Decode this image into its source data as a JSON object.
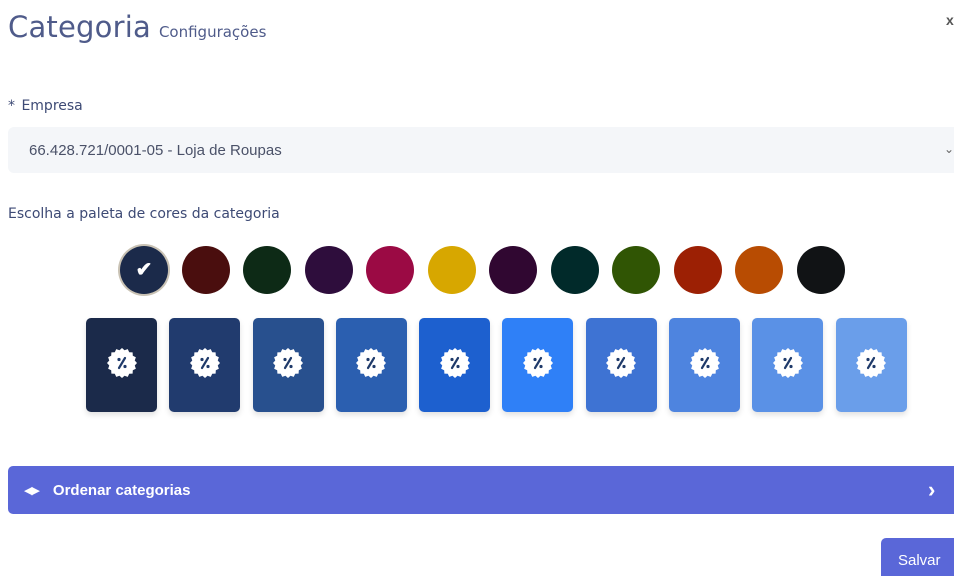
{
  "header": {
    "title": "Categoria",
    "subtitle": "Configurações",
    "close_label": "x"
  },
  "empresa": {
    "required_mark": "*",
    "label": "Empresa",
    "value": "66.428.721/0001-05 - Loja de Roupas"
  },
  "palette": {
    "label": "Escolha a paleta de cores da categoria",
    "selected_index": 0,
    "colors": [
      "#1b2a4a",
      "#4a0e0e",
      "#0d2a16",
      "#2e0d3c",
      "#9b0a44",
      "#d7a700",
      "#300731",
      "#012a2a",
      "#305504",
      "#9c2004",
      "#b84c02",
      "#111315"
    ]
  },
  "shades": {
    "icon_name": "percent-badge-icon",
    "colors": [
      "#1b2a4a",
      "#213b6e",
      "#28508e",
      "#2b5fb0",
      "#1d60cf",
      "#2f80f7",
      "#3e73d3",
      "#4e84df",
      "#5a91e6",
      "#6a9eea"
    ]
  },
  "order": {
    "icon_name": "left-right-arrows-icon",
    "label": "Ordenar categorias",
    "chevron_icon": "chevron-right-icon"
  },
  "actions": {
    "save_label": "Salvar"
  }
}
